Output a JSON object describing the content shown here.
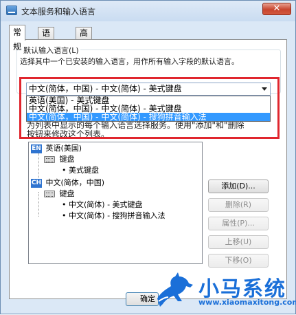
{
  "window": {
    "title": "文本服务和输入语言",
    "close_label": "✕"
  },
  "tabs": [
    {
      "label": "常规",
      "active": true
    },
    {
      "label": "语言栏",
      "active": false
    },
    {
      "label": "高级键设置",
      "active": false
    }
  ],
  "default_input": {
    "legend": "默认输入语言(L)",
    "description": "选择其中一个已安装的输入语言，用作所有输入字段的默认语言。",
    "selected_value": "中文(简体，中国) - 中文(简体) - 美式键盘",
    "options": [
      "英语(美国) - 美式键盘",
      "中文(简体，中国) - 中文(简体) - 美式键盘",
      "中文(简体，中国) - 中文(简体) - 搜狗拼音输入法"
    ],
    "highlighted_index": 2
  },
  "installed_services": {
    "description_line1": "为列表中显示的每个输入语言选择服务。使用\"添加\"和\"删除",
    "description_line2": "按钮来修改这个列表。"
  },
  "tree": {
    "languages": [
      {
        "code": "EN",
        "name": "英语(美国)",
        "group_label": "键盘",
        "items": [
          "美式键盘"
        ]
      },
      {
        "code": "CH",
        "name": "中文(简体，中国)",
        "group_label": "键盘",
        "items": [
          "中文(简体) - 美式键盘",
          "中文(简体) - 搜狗拼音输入法"
        ]
      }
    ]
  },
  "buttons": {
    "add": "添加(D)...",
    "remove": "删除(R)",
    "properties": "属性(P)...",
    "move_up": "上移(U)",
    "move_down": "下移(O)",
    "ok": "确定"
  },
  "watermark": {
    "brand": "小马系统",
    "url": "www.xiaomaxitong.com"
  },
  "colors": {
    "selection": "#3399ff",
    "highlight_box": "#e0262e",
    "brand_blue": "#1a6fd8"
  }
}
